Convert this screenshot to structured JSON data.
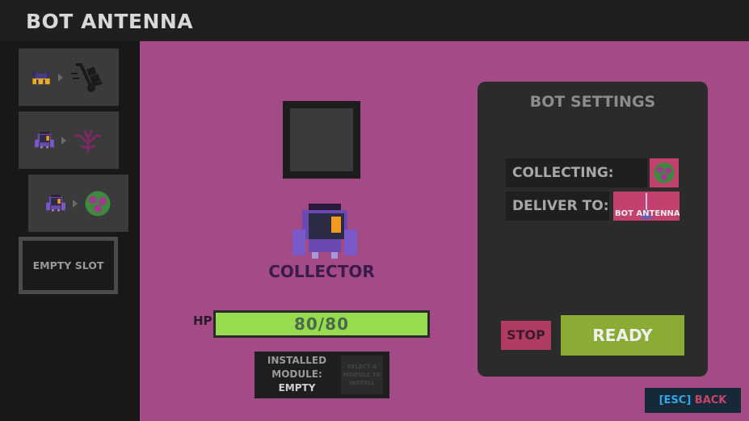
{
  "header": {
    "title": "BOT ANTENNA"
  },
  "sidebar": {
    "slots": [
      {
        "bot": "hauler-bot-icon",
        "task": "hand-truck-icon"
      },
      {
        "bot": "collector-bot-icon",
        "task": "coral-plant-icon"
      },
      {
        "bot": "collector-bot-icon",
        "task": "berry-bush-icon",
        "selected": true
      },
      {
        "label": "EMPTY SLOT"
      }
    ]
  },
  "bot": {
    "name": "COLLECTOR",
    "hp_label": "HP",
    "hp": "80/80",
    "hp_fraction": 1.0
  },
  "module": {
    "label_1": "INSTALLED",
    "label_2": "MODULE:",
    "value": "EMPTY",
    "select_hint": "SELECT A MODULE TO INSTALL"
  },
  "settings": {
    "title": "BOT SETTINGS",
    "collecting_label": "COLLECTING:",
    "collecting_icon": "berry-bush-icon",
    "deliver_label": "DELIVER TO:",
    "deliver_target": "BOT ANTENNA",
    "stop": "STOP",
    "ready": "READY"
  },
  "back": {
    "key": "[ESC]",
    "label": "BACK"
  },
  "colors": {
    "background": "#a44b87",
    "hp_fill": "#97dc4f",
    "ready": "#8aab34",
    "stop": "#b13b62",
    "accent_key": "#2aa8e8"
  }
}
